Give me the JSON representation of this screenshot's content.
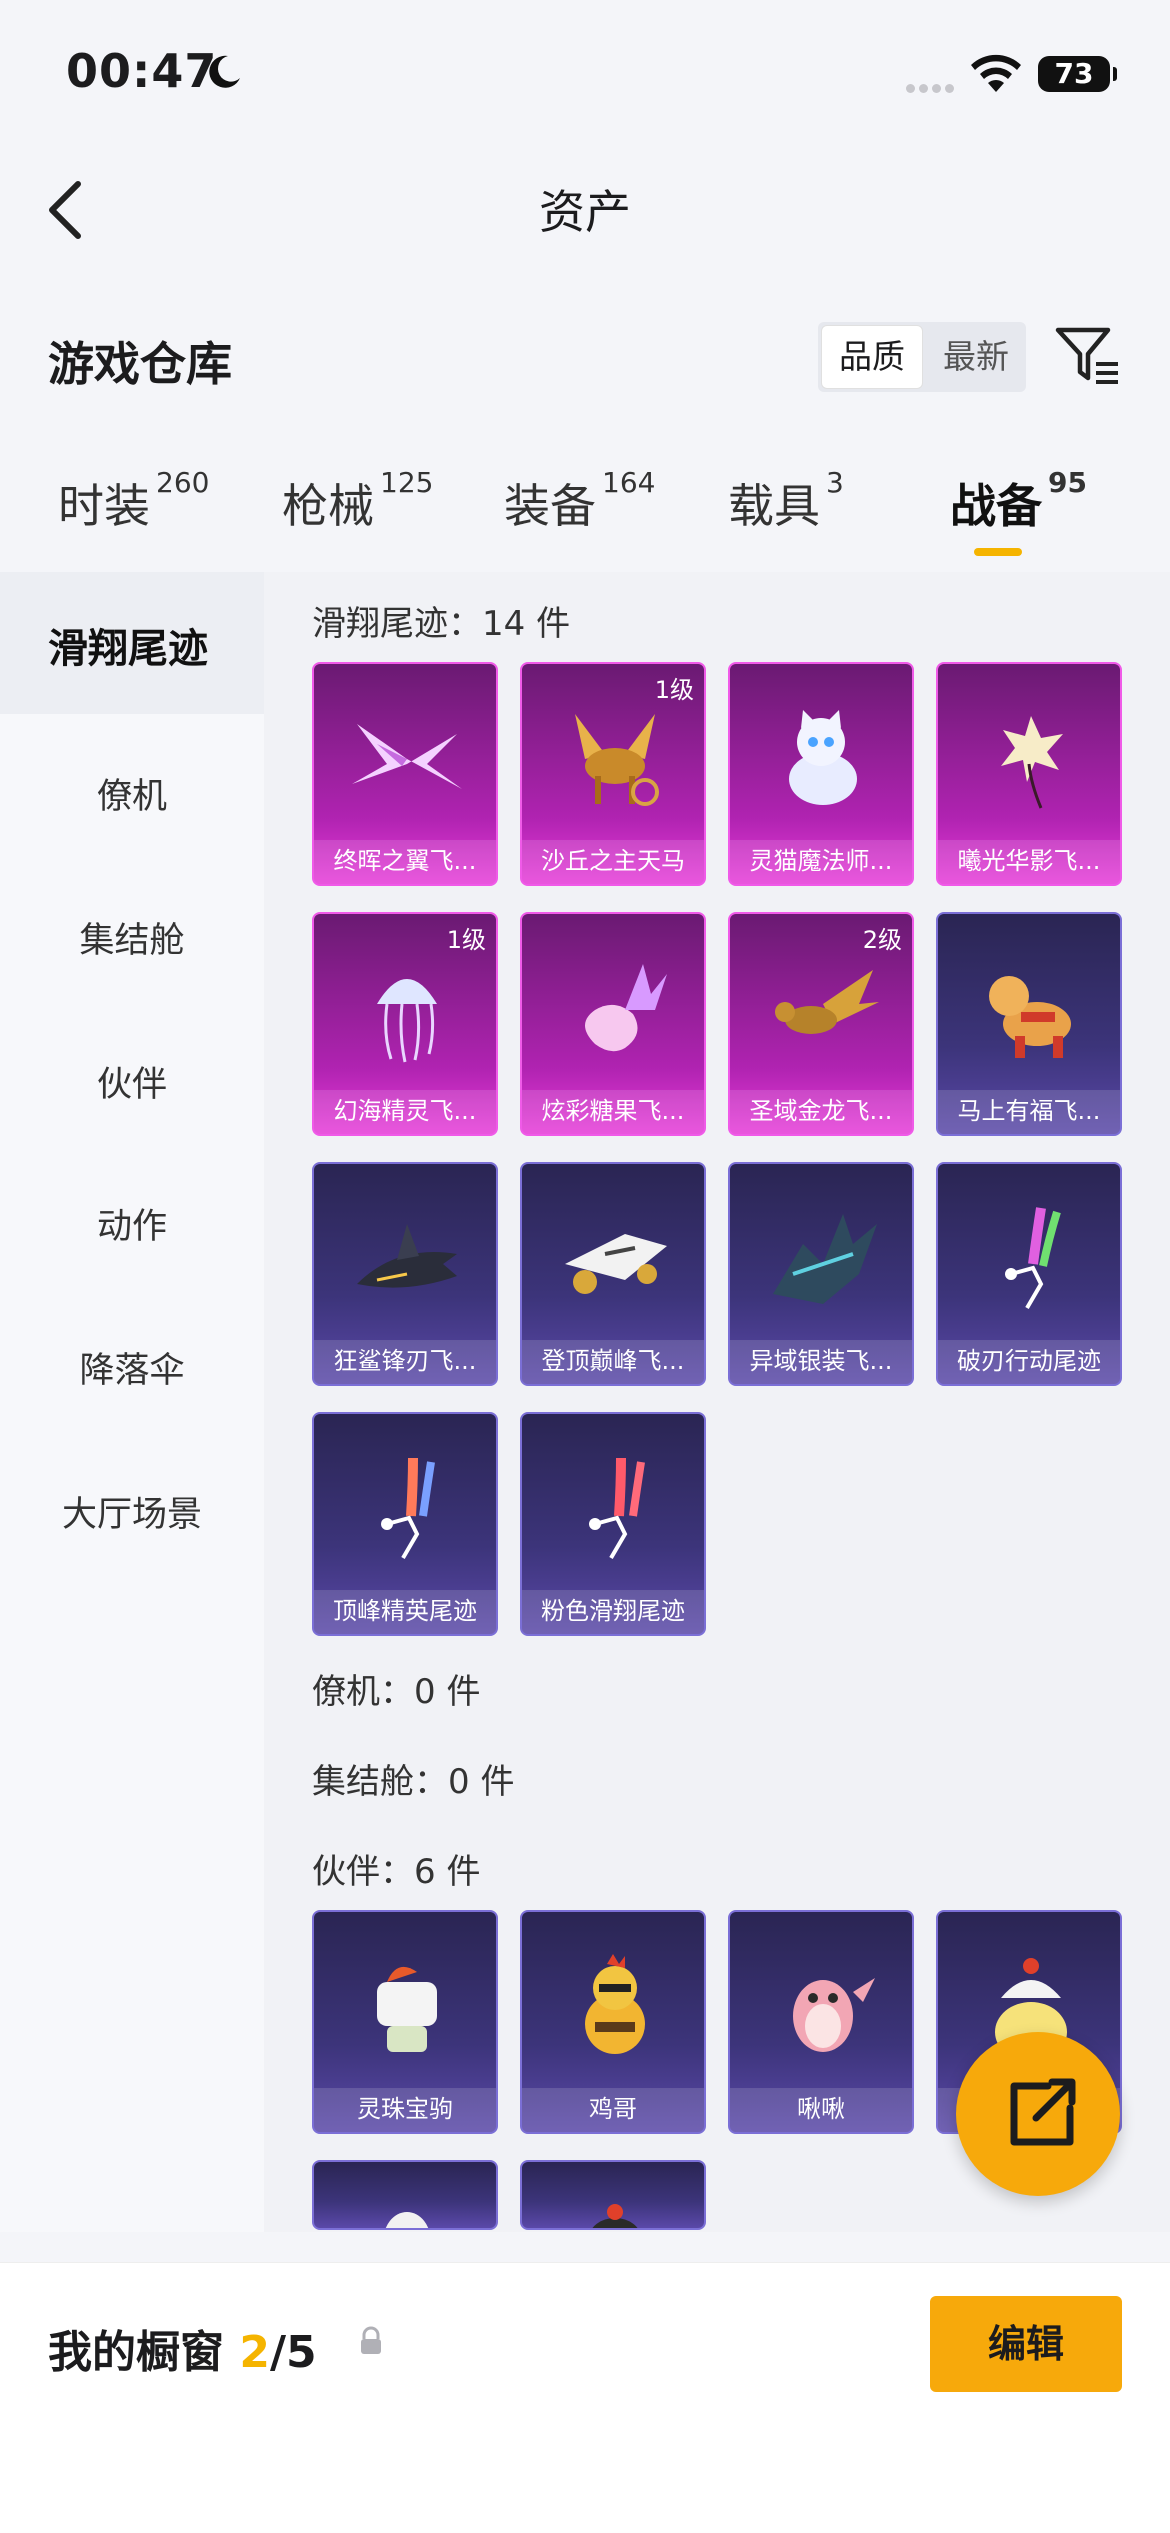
{
  "status": {
    "time": "00:47",
    "battery": "73"
  },
  "nav": {
    "title": "资产"
  },
  "header": {
    "title": "游戏仓库",
    "sort": [
      "品质",
      "最新"
    ]
  },
  "tabs": [
    {
      "label": "时装",
      "count": "260"
    },
    {
      "label": "枪械",
      "count": "125"
    },
    {
      "label": "装备",
      "count": "164"
    },
    {
      "label": "载具",
      "count": "3"
    },
    {
      "label": "战备",
      "count": "95"
    }
  ],
  "sidebar": [
    "滑翔尾迹",
    "僚机",
    "集结舱",
    "伙伴",
    "动作",
    "降落伞",
    "大厅场景"
  ],
  "sections": {
    "glide": "滑翔尾迹：14 件",
    "wingman": "僚机：0 件",
    "rally": "集结舱：0 件",
    "partner": "伙伴：6 件"
  },
  "glide_items": [
    {
      "name": "终晖之翼飞...",
      "level": ""
    },
    {
      "name": "沙丘之主天马",
      "level": "1级"
    },
    {
      "name": "灵猫魔法师...",
      "level": ""
    },
    {
      "name": "曦光华影飞...",
      "level": ""
    },
    {
      "name": "幻海精灵飞...",
      "level": "1级"
    },
    {
      "name": "炫彩糖果飞...",
      "level": ""
    },
    {
      "name": "圣域金龙飞...",
      "level": "2级"
    },
    {
      "name": "马上有福飞...",
      "level": ""
    },
    {
      "name": "狂鲨锋刃飞...",
      "level": ""
    },
    {
      "name": "登顶巅峰飞...",
      "level": ""
    },
    {
      "name": "异域银装飞...",
      "level": ""
    },
    {
      "name": "破刃行动尾迹",
      "level": ""
    },
    {
      "name": "顶峰精英尾迹",
      "level": ""
    },
    {
      "name": "粉色滑翔尾迹",
      "level": ""
    }
  ],
  "partner_items": [
    {
      "name": "灵珠宝驹"
    },
    {
      "name": "鸡哥"
    },
    {
      "name": "啾啾"
    }
  ],
  "bottom": {
    "label": "我的橱窗",
    "count": "2",
    "total": "/5",
    "edit": "编辑"
  },
  "colors": {
    "accent": "#f7a90b",
    "pink_card": "#b023b1",
    "purple_card": "#3c347a"
  }
}
